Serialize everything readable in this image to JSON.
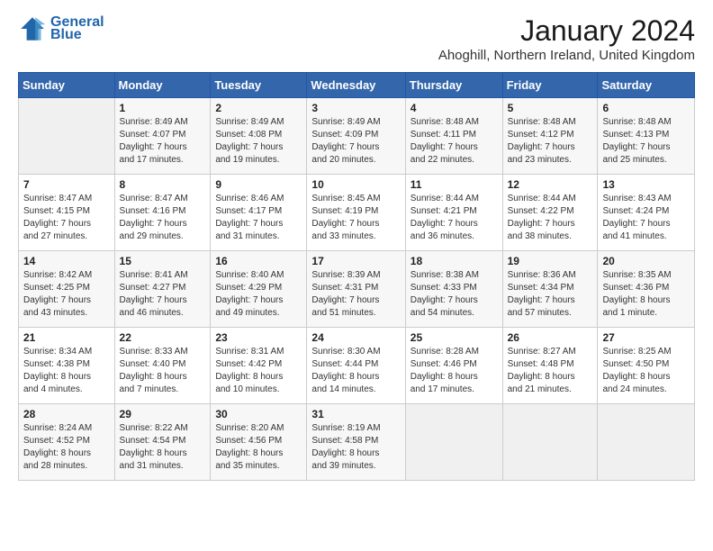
{
  "header": {
    "logo_line1": "General",
    "logo_line2": "Blue",
    "month": "January 2024",
    "location": "Ahoghill, Northern Ireland, United Kingdom"
  },
  "weekdays": [
    "Sunday",
    "Monday",
    "Tuesday",
    "Wednesday",
    "Thursday",
    "Friday",
    "Saturday"
  ],
  "weeks": [
    [
      {
        "day": "",
        "info": ""
      },
      {
        "day": "1",
        "info": "Sunrise: 8:49 AM\nSunset: 4:07 PM\nDaylight: 7 hours\nand 17 minutes."
      },
      {
        "day": "2",
        "info": "Sunrise: 8:49 AM\nSunset: 4:08 PM\nDaylight: 7 hours\nand 19 minutes."
      },
      {
        "day": "3",
        "info": "Sunrise: 8:49 AM\nSunset: 4:09 PM\nDaylight: 7 hours\nand 20 minutes."
      },
      {
        "day": "4",
        "info": "Sunrise: 8:48 AM\nSunset: 4:11 PM\nDaylight: 7 hours\nand 22 minutes."
      },
      {
        "day": "5",
        "info": "Sunrise: 8:48 AM\nSunset: 4:12 PM\nDaylight: 7 hours\nand 23 minutes."
      },
      {
        "day": "6",
        "info": "Sunrise: 8:48 AM\nSunset: 4:13 PM\nDaylight: 7 hours\nand 25 minutes."
      }
    ],
    [
      {
        "day": "7",
        "info": "Sunrise: 8:47 AM\nSunset: 4:15 PM\nDaylight: 7 hours\nand 27 minutes."
      },
      {
        "day": "8",
        "info": "Sunrise: 8:47 AM\nSunset: 4:16 PM\nDaylight: 7 hours\nand 29 minutes."
      },
      {
        "day": "9",
        "info": "Sunrise: 8:46 AM\nSunset: 4:17 PM\nDaylight: 7 hours\nand 31 minutes."
      },
      {
        "day": "10",
        "info": "Sunrise: 8:45 AM\nSunset: 4:19 PM\nDaylight: 7 hours\nand 33 minutes."
      },
      {
        "day": "11",
        "info": "Sunrise: 8:44 AM\nSunset: 4:21 PM\nDaylight: 7 hours\nand 36 minutes."
      },
      {
        "day": "12",
        "info": "Sunrise: 8:44 AM\nSunset: 4:22 PM\nDaylight: 7 hours\nand 38 minutes."
      },
      {
        "day": "13",
        "info": "Sunrise: 8:43 AM\nSunset: 4:24 PM\nDaylight: 7 hours\nand 41 minutes."
      }
    ],
    [
      {
        "day": "14",
        "info": "Sunrise: 8:42 AM\nSunset: 4:25 PM\nDaylight: 7 hours\nand 43 minutes."
      },
      {
        "day": "15",
        "info": "Sunrise: 8:41 AM\nSunset: 4:27 PM\nDaylight: 7 hours\nand 46 minutes."
      },
      {
        "day": "16",
        "info": "Sunrise: 8:40 AM\nSunset: 4:29 PM\nDaylight: 7 hours\nand 49 minutes."
      },
      {
        "day": "17",
        "info": "Sunrise: 8:39 AM\nSunset: 4:31 PM\nDaylight: 7 hours\nand 51 minutes."
      },
      {
        "day": "18",
        "info": "Sunrise: 8:38 AM\nSunset: 4:33 PM\nDaylight: 7 hours\nand 54 minutes."
      },
      {
        "day": "19",
        "info": "Sunrise: 8:36 AM\nSunset: 4:34 PM\nDaylight: 7 hours\nand 57 minutes."
      },
      {
        "day": "20",
        "info": "Sunrise: 8:35 AM\nSunset: 4:36 PM\nDaylight: 8 hours\nand 1 minute."
      }
    ],
    [
      {
        "day": "21",
        "info": "Sunrise: 8:34 AM\nSunset: 4:38 PM\nDaylight: 8 hours\nand 4 minutes."
      },
      {
        "day": "22",
        "info": "Sunrise: 8:33 AM\nSunset: 4:40 PM\nDaylight: 8 hours\nand 7 minutes."
      },
      {
        "day": "23",
        "info": "Sunrise: 8:31 AM\nSunset: 4:42 PM\nDaylight: 8 hours\nand 10 minutes."
      },
      {
        "day": "24",
        "info": "Sunrise: 8:30 AM\nSunset: 4:44 PM\nDaylight: 8 hours\nand 14 minutes."
      },
      {
        "day": "25",
        "info": "Sunrise: 8:28 AM\nSunset: 4:46 PM\nDaylight: 8 hours\nand 17 minutes."
      },
      {
        "day": "26",
        "info": "Sunrise: 8:27 AM\nSunset: 4:48 PM\nDaylight: 8 hours\nand 21 minutes."
      },
      {
        "day": "27",
        "info": "Sunrise: 8:25 AM\nSunset: 4:50 PM\nDaylight: 8 hours\nand 24 minutes."
      }
    ],
    [
      {
        "day": "28",
        "info": "Sunrise: 8:24 AM\nSunset: 4:52 PM\nDaylight: 8 hours\nand 28 minutes."
      },
      {
        "day": "29",
        "info": "Sunrise: 8:22 AM\nSunset: 4:54 PM\nDaylight: 8 hours\nand 31 minutes."
      },
      {
        "day": "30",
        "info": "Sunrise: 8:20 AM\nSunset: 4:56 PM\nDaylight: 8 hours\nand 35 minutes."
      },
      {
        "day": "31",
        "info": "Sunrise: 8:19 AM\nSunset: 4:58 PM\nDaylight: 8 hours\nand 39 minutes."
      },
      {
        "day": "",
        "info": ""
      },
      {
        "day": "",
        "info": ""
      },
      {
        "day": "",
        "info": ""
      }
    ]
  ]
}
